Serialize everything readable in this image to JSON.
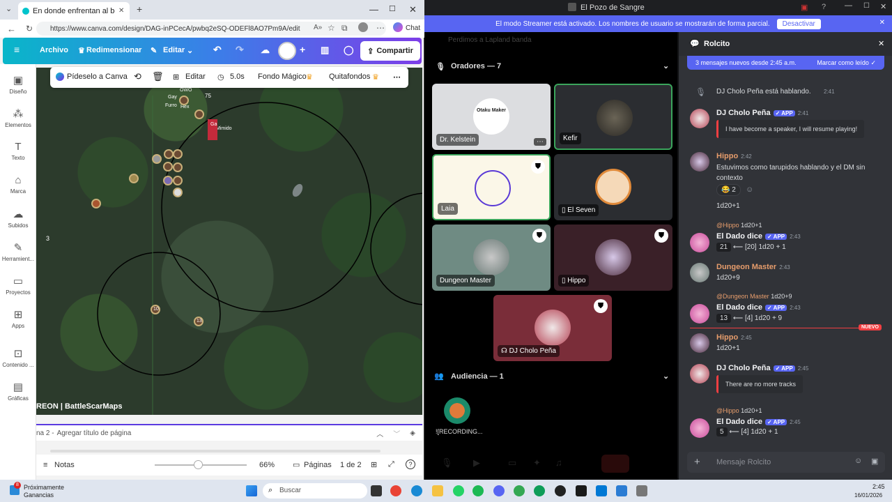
{
  "browser": {
    "tab_title": "En donde enfrentan al boss y al cr",
    "url": "https://www.canva.com/design/DAG-inPCecA/pwbq2eSQ-ODEFl8AO7Pm9A/edit",
    "chat_label": "Chat"
  },
  "canva": {
    "menu": [
      "Archivo",
      "Redimensionar",
      "Editar"
    ],
    "share": "Compartir",
    "float_toolbar": {
      "ask": "Pídeselo a Canva",
      "edit": "Editar",
      "duration": "5.0s",
      "magic_bg": "Fondo Mágico",
      "bg_remover": "Quitafondos"
    },
    "sidebar": [
      "Diseño",
      "Elementos",
      "Texto",
      "Marca",
      "Subidos",
      "Herramient...",
      "Proyectos",
      "Apps",
      "Contenido ...",
      "Gráficas"
    ],
    "map": {
      "labels": [
        "OWO",
        "Gay",
        "Furro",
        "Hex",
        "75",
        "Mimido",
        "Ga",
        "3",
        "10",
        "13"
      ],
      "watermark": "REON | BattleScarMaps"
    },
    "page": {
      "label": "na 2 -",
      "add_title": "Agregar título de página"
    },
    "bottom": {
      "notes": "Notas",
      "zoom": "66%",
      "pages": "Páginas",
      "page_count": "1 de 2"
    }
  },
  "discord": {
    "window_title": "El Pozo de Sangre",
    "streamer_notice": "El modo Streamer está activado. Los nombres de usuario se mostrarán de forma parcial.",
    "deactivate": "Desactivar",
    "header_faded": "Perdimos a Lapland banda",
    "speakers_header": "Oradores — 7",
    "audience_header": "Audiencia — 1",
    "speakers": [
      {
        "name": "Dr. Kelstein",
        "bg": "#dcdde0"
      },
      {
        "name": "Kefir",
        "bg": "#2b2d31"
      },
      {
        "name": "Laia",
        "bg": "#fbf7e8"
      },
      {
        "name": "El Seven",
        "bg": "#2b2d31"
      },
      {
        "name": "Dungeon Master",
        "bg": "#6f8b83"
      },
      {
        "name": "Hippo",
        "bg": "#3a2028"
      },
      {
        "name": "DJ Cholo Peña",
        "bg": "#7a2d39"
      }
    ],
    "audience": [
      {
        "name": "![RECORDING..."
      }
    ],
    "avatar_text": "Otaku Maker",
    "chat": {
      "title": "Rolcito",
      "new_messages": "3 mensajes nuevos desde 2:45 a.m.",
      "mark_read": "Marcar como leído",
      "system": "DJ Cholo Peña está hablando.",
      "system_time": "2:41",
      "new_badge": "NUEVO",
      "input_placeholder": "Mensaje Rolcito",
      "messages": [
        {
          "user": "DJ Cholo Peña",
          "app": "APP",
          "time": "2:41",
          "embed": "I have become a speaker, I will resume playing!"
        },
        {
          "user": "Hippo",
          "time": "2:42",
          "text": "Estuvimos como tarupidos hablando y el DM sin contexto",
          "reaction_count": "2",
          "text2": "1d20+1"
        },
        {
          "reply": "@Hippo",
          "reply_text": "1d20+1",
          "user": "El Dado dice",
          "app": "APP",
          "time": "2:43",
          "roll_total": "21",
          "roll": "⟵ [20] 1d20 + 1"
        },
        {
          "user": "Dungeon Master",
          "time": "2:43",
          "text": "1d20+9"
        },
        {
          "reply": "@Dungeon Master",
          "reply_text": "1d20+9",
          "user": "El Dado dice",
          "app": "APP",
          "time": "2:43",
          "roll_total": "13",
          "roll": "⟵ [4] 1d20 + 9"
        },
        {
          "user": "Hippo",
          "time": "2:45",
          "text": "1d20+1"
        },
        {
          "user": "DJ Cholo Peña",
          "app": "APP",
          "time": "2:45",
          "embed": "There are no more tracks"
        },
        {
          "reply": "@Hippo",
          "reply_text": "1d20+1",
          "user": "El Dado dice",
          "app": "APP",
          "time": "2:45",
          "roll_total": "5",
          "roll": "⟵ [4] 1d20 + 1"
        }
      ]
    }
  },
  "taskbar": {
    "weather_title": "Próximamente",
    "weather_sub": "Ganancias",
    "weather_badge": "8",
    "search": "Buscar",
    "time": "2:45",
    "date": "16/01/2026"
  }
}
